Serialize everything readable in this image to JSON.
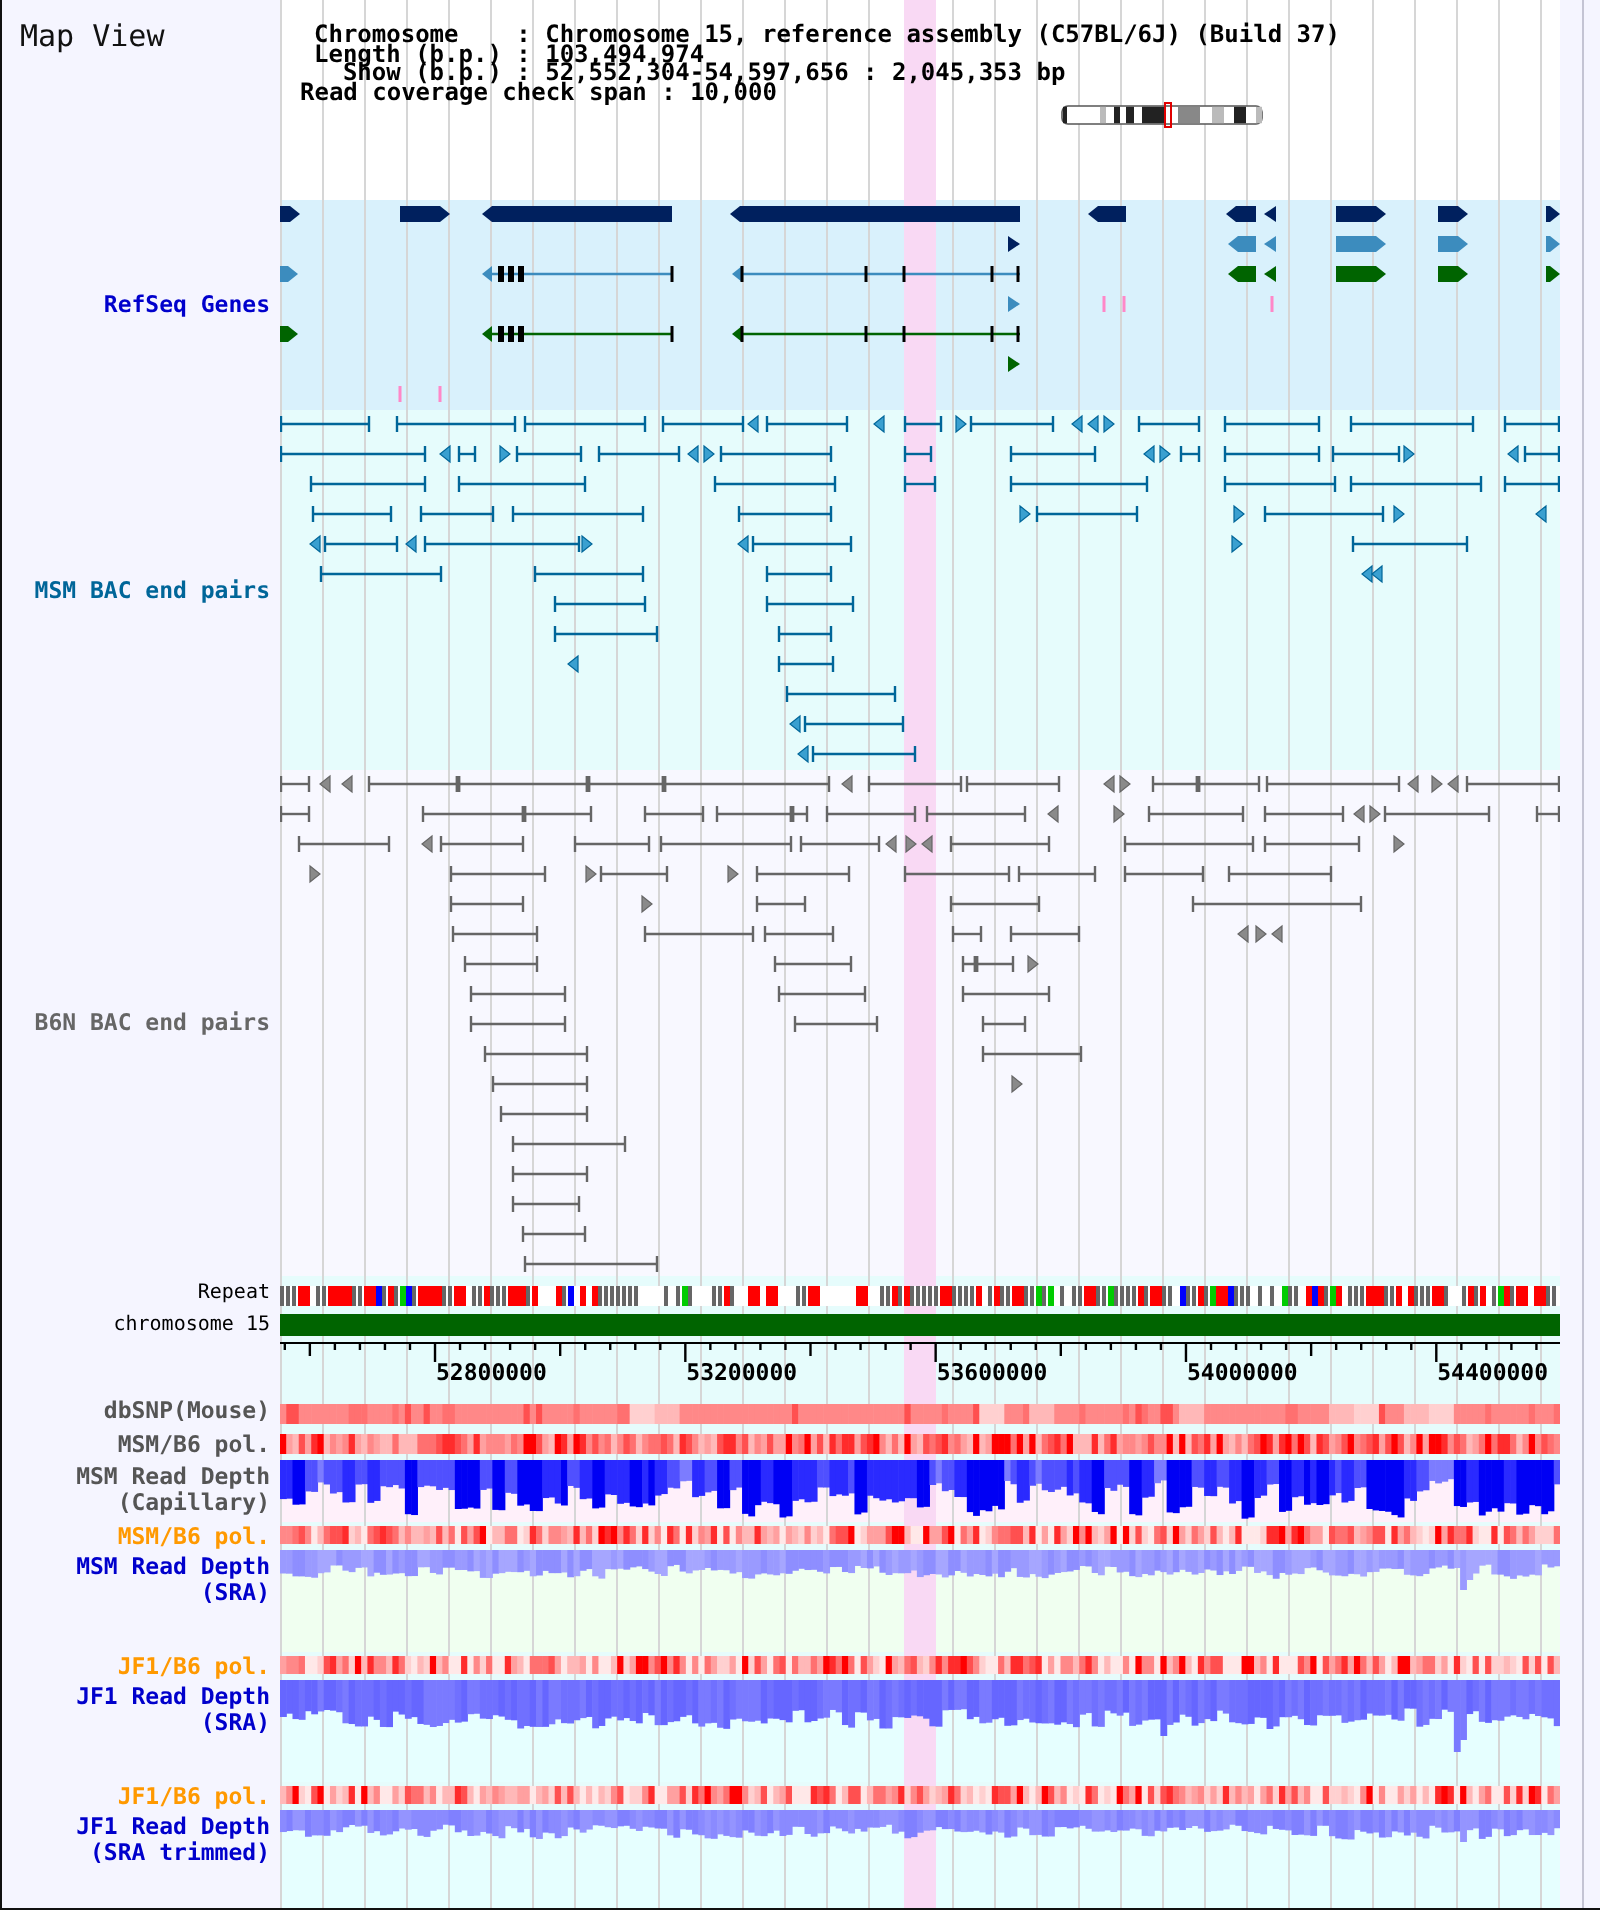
{
  "title": "Map View",
  "header": {
    "fields": [
      "Chromosome    : Chromosome 15, reference assembly (C57BL/6J) (Build 37)",
      "Length (b.p.) : 103,494,974",
      "  Show (b.p.) : 52,552,304-54,597,656 : 2,045,353 bp"
    ],
    "coverage": "Read coverage check span : 10,000"
  },
  "tracks": [
    {
      "kind": "genes",
      "label": "RefSeq Genes",
      "color": "#0000cc"
    },
    {
      "kind": "bac_pairs",
      "label": "MSM BAC end pairs",
      "color": "#006699"
    },
    {
      "kind": "bac_pairs",
      "label": "B6N BAC end pairs",
      "color": "#666666"
    },
    {
      "kind": "repeat",
      "label": "Repeat",
      "color": "#000000"
    },
    {
      "kind": "chromosome",
      "label": "chromosome 15",
      "color": "#000000"
    },
    {
      "kind": "ruler",
      "tick_labels": [
        "52800000",
        "53200000",
        "53600000",
        "54000000",
        "54400000"
      ]
    },
    {
      "kind": "heatmap",
      "label": "dbSNP(Mouse)",
      "color": "#555555"
    },
    {
      "kind": "heatmap",
      "label": "MSM/B6 pol.",
      "color": "#555555"
    },
    {
      "kind": "depth",
      "label": "MSM Read Depth (Capillary)",
      "color": "#555555"
    },
    {
      "kind": "heatmap",
      "label": "MSM/B6 pol.",
      "color": "#ff9900"
    },
    {
      "kind": "depth",
      "label": "MSM Read Depth (SRA)",
      "color": "#0000cc"
    },
    {
      "kind": "heatmap",
      "label": "JF1/B6 pol.",
      "color": "#ff9900"
    },
    {
      "kind": "depth",
      "label": "JF1 Read Depth (SRA)",
      "color": "#0000cc"
    },
    {
      "kind": "heatmap",
      "label": "JF1/B6 pol.",
      "color": "#ff9900"
    },
    {
      "kind": "depth",
      "label": "JF1 Read Depth (SRA trimmed)",
      "color": "#0000cc"
    }
  ]
}
